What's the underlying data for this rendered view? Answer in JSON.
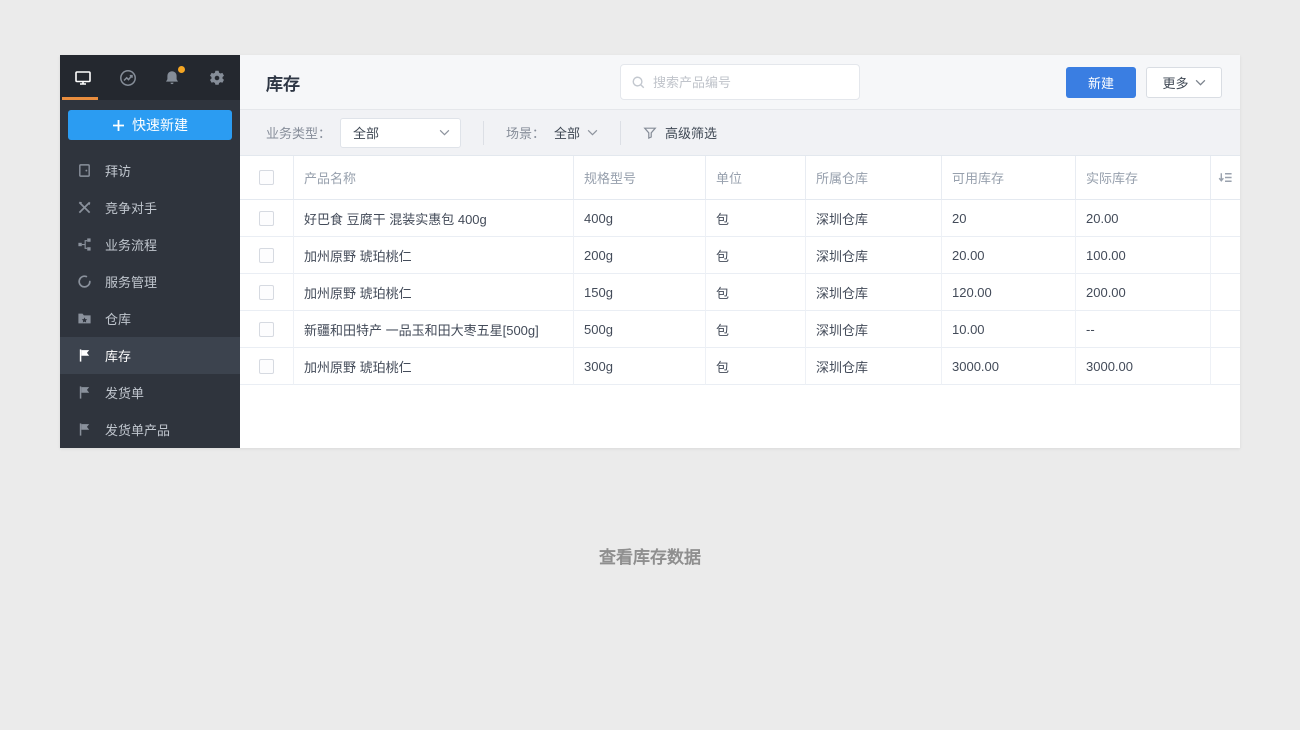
{
  "colors": {
    "page_bg": "#ebebeb",
    "sidebar_bg": "#2f343d",
    "sidebar_topbar_bg": "#24282f",
    "sidebar_active_bg": "#3c434e",
    "quick_create_blue": "#2b9cf2",
    "primary_button_blue": "#3a7ee2",
    "active_tab_underline_orange": "#e98d3e",
    "notification_dot_orange": "#f5a623"
  },
  "topbar": {
    "icons": [
      {
        "name": "monitor-icon",
        "active": true
      },
      {
        "name": "trend-icon",
        "active": false
      },
      {
        "name": "bell-icon",
        "active": false,
        "has_notification_dot": true
      },
      {
        "name": "gear-icon",
        "active": false
      }
    ]
  },
  "sidebar": {
    "quick_create_label": "快速新建",
    "items": [
      {
        "label": "拜访",
        "icon": "door-icon",
        "active": false
      },
      {
        "label": "竞争对手",
        "icon": "crossed-tools-icon",
        "active": false
      },
      {
        "label": "业务流程",
        "icon": "flow-icon",
        "active": false
      },
      {
        "label": "服务管理",
        "icon": "loop-icon",
        "active": false
      },
      {
        "label": "仓库",
        "icon": "folder-star-icon",
        "active": false
      },
      {
        "label": "库存",
        "icon": "flag-icon",
        "active": true
      },
      {
        "label": "发货单",
        "icon": "flag-icon",
        "active": false
      },
      {
        "label": "发货单产品",
        "icon": "flag-icon",
        "active": false
      }
    ]
  },
  "header": {
    "title": "库存",
    "search_placeholder": "搜索产品编号",
    "new_button_label": "新建",
    "more_button_label": "更多"
  },
  "filter_bar": {
    "business_type_label": "业务类型：",
    "business_type_value": "全部",
    "scene_label": "场景：",
    "scene_value": "全部",
    "advanced_filter_label": "高级筛选"
  },
  "table": {
    "columns": [
      "产品名称",
      "规格型号",
      "单位",
      "所属仓库",
      "可用库存",
      "实际库存"
    ],
    "rows": [
      {
        "name": "好巴食 豆腐干 混装实惠包 400g",
        "spec": "400g",
        "unit": "包",
        "warehouse": "深圳仓库",
        "available": "20",
        "actual": "20.00"
      },
      {
        "name": "加州原野 琥珀桃仁",
        "spec": "200g",
        "unit": "包",
        "warehouse": "深圳仓库",
        "available": "20.00",
        "actual": "100.00"
      },
      {
        "name": "加州原野 琥珀桃仁",
        "spec": "150g",
        "unit": "包",
        "warehouse": "深圳仓库",
        "available": "120.00",
        "actual": "200.00"
      },
      {
        "name": "新疆和田特产 一品玉和田大枣五星[500g]",
        "spec": "500g",
        "unit": "包",
        "warehouse": "深圳仓库",
        "available": "10.00",
        "actual": "--"
      },
      {
        "name": "加州原野 琥珀桃仁",
        "spec": "300g",
        "unit": "包",
        "warehouse": "深圳仓库",
        "available": "3000.00",
        "actual": "3000.00"
      }
    ]
  },
  "caption": "查看库存数据"
}
